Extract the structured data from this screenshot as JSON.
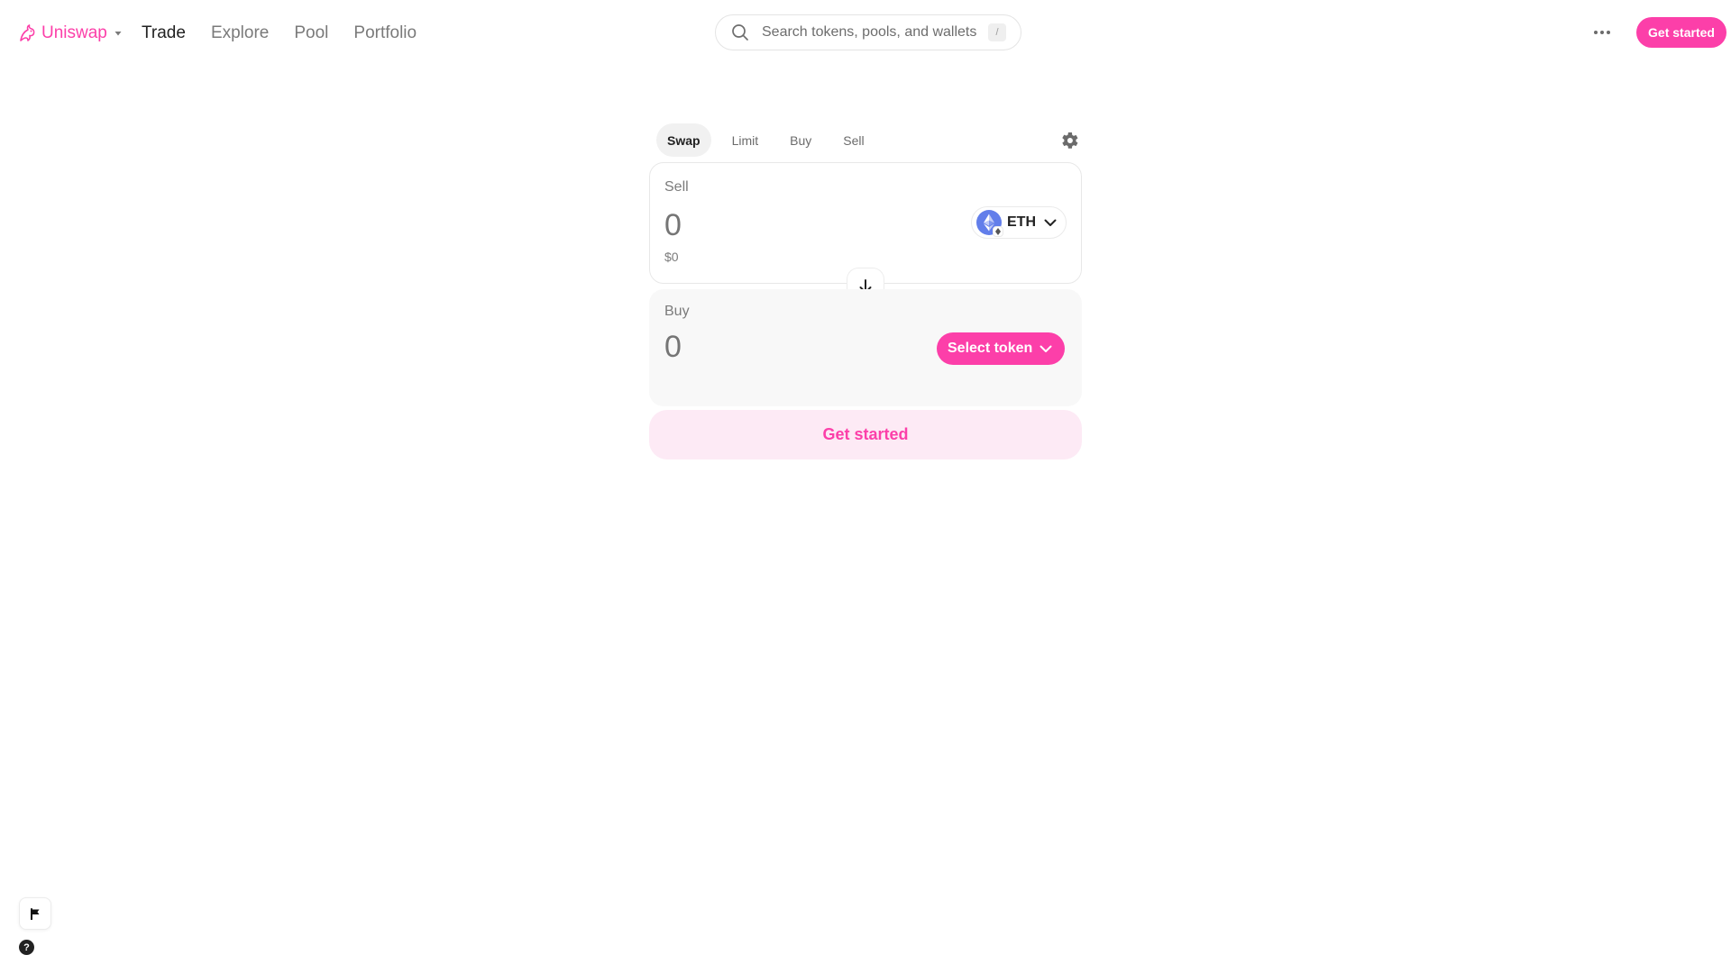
{
  "colors": {
    "accent": "#fc3fa9",
    "accent_soft": "#fdeaf5",
    "eth_blue": "#627eea"
  },
  "header": {
    "brand": {
      "name": "Uniswap",
      "logo_icon": "uniswap-unicorn-icon",
      "caret_icon": "caret-down-icon"
    },
    "nav": [
      {
        "label": "Trade",
        "active": true
      },
      {
        "label": "Explore",
        "active": false
      },
      {
        "label": "Pool",
        "active": false
      },
      {
        "label": "Portfolio",
        "active": false
      }
    ],
    "search": {
      "placeholder": "Search tokens, pools, and wallets",
      "shortcut": "/",
      "icon": "search-icon"
    },
    "more_icon": "more-horizontal-icon",
    "get_started": "Get started"
  },
  "swap": {
    "tabs": [
      {
        "label": "Swap",
        "active": true
      },
      {
        "label": "Limit",
        "active": false
      },
      {
        "label": "Buy",
        "active": false
      },
      {
        "label": "Sell",
        "active": false
      }
    ],
    "settings_icon": "gear-icon",
    "sell": {
      "label": "Sell",
      "amount": "0",
      "usd_value": "$0",
      "token": {
        "symbol": "ETH",
        "icon": "eth-icon"
      }
    },
    "flip_icon": "arrow-down-icon",
    "buy": {
      "label": "Buy",
      "amount": "0",
      "select_token": "Select token"
    },
    "cta": "Get started"
  },
  "footer": {
    "flag_icon": "flag-icon",
    "help_label": "?"
  }
}
